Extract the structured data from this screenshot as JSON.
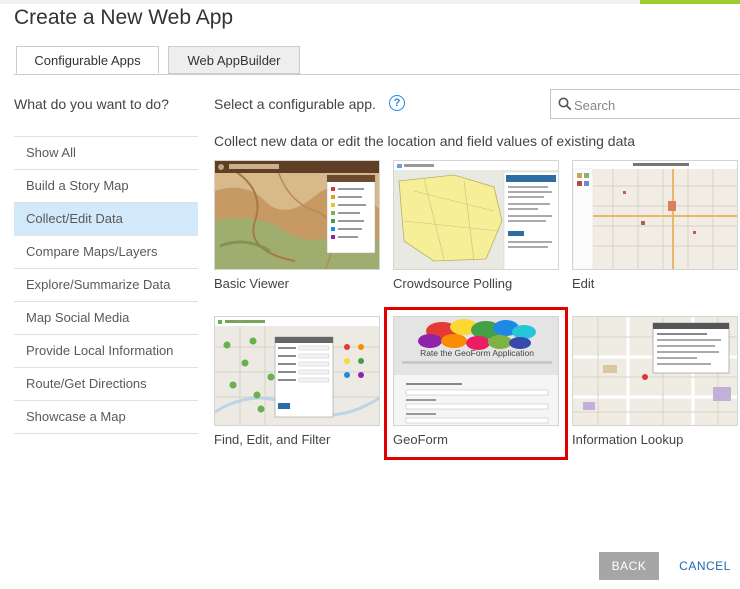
{
  "dialog": {
    "title": "Create a New Web App"
  },
  "tabs": [
    {
      "label": "Configurable Apps",
      "active": true
    },
    {
      "label": "Web AppBuilder",
      "active": false
    }
  ],
  "sidebar": {
    "question": "What do you want to do?",
    "items": [
      {
        "label": "Show All",
        "selected": false
      },
      {
        "label": "Build a Story Map",
        "selected": false
      },
      {
        "label": "Collect/Edit Data",
        "selected": true
      },
      {
        "label": "Compare Maps/Layers",
        "selected": false
      },
      {
        "label": "Explore/Summarize Data",
        "selected": false
      },
      {
        "label": "Map Social Media",
        "selected": false
      },
      {
        "label": "Provide Local Information",
        "selected": false
      },
      {
        "label": "Route/Get Directions",
        "selected": false
      },
      {
        "label": "Showcase a Map",
        "selected": false
      }
    ]
  },
  "main": {
    "select_label": "Select a configurable app.",
    "help_icon": "?",
    "description": "Collect new data or edit the location and field values of existing data",
    "search": {
      "placeholder": "Search",
      "value": ""
    },
    "apps": [
      {
        "label": "Basic Viewer",
        "thumbnail": "terrain-map-with-legend"
      },
      {
        "label": "Crowdsource Polling",
        "thumbnail": "parcel-map-with-panel"
      },
      {
        "label": "Edit",
        "thumbnail": "street-map-with-toolbar"
      },
      {
        "label": "Find, Edit, and Filter",
        "thumbnail": "map-with-markers-and-form"
      },
      {
        "label": "GeoForm",
        "thumbnail": "form-with-speech-bubbles",
        "highlighted": true,
        "banner_text": "Rate the GeoForm Application"
      },
      {
        "label": "Information Lookup",
        "thumbnail": "street-map-with-popup"
      }
    ]
  },
  "footer": {
    "back_label": "BACK",
    "cancel_label": "CANCEL"
  },
  "colors": {
    "selected_bg": "#d2e9f9",
    "highlight_border": "#e00000",
    "link_blue": "#1a6aaf",
    "help_blue": "#1e88e5",
    "back_button_bg": "#a6a6a6"
  }
}
